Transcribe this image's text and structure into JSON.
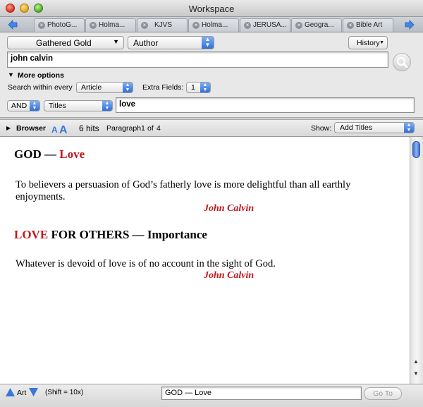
{
  "window": {
    "title": "Workspace"
  },
  "tabs": [
    {
      "label": "PhotoG..."
    },
    {
      "label": "Holma..."
    },
    {
      "label": "KJVS"
    },
    {
      "label": "Holma..."
    },
    {
      "label": "JERUSA..."
    },
    {
      "label": "Geogra..."
    },
    {
      "label": "Bible Art"
    }
  ],
  "search": {
    "library_select": "Gathered Gold",
    "field_select": "Author",
    "history_button": "History",
    "query_value": "john calvin",
    "more_options_label": "More options",
    "search_within_label": "Search within every",
    "search_within_select": "Article",
    "extra_fields_label": "Extra Fields:",
    "extra_fields_select": "1",
    "operator_select": "AND",
    "extra_field_select": "Titles",
    "extra_query_value": "love"
  },
  "browser": {
    "browser_label": "Browser",
    "hits": "6 hits",
    "paragraph_label": "Paragraph",
    "paragraph_current": "1",
    "paragraph_of": "of",
    "paragraph_total": "4",
    "show_label": "Show:",
    "show_select": "Add Titles"
  },
  "content": {
    "entries": [
      {
        "heading_black": "GOD —",
        "heading_red": "Love",
        "text": "To believers a persuasion of God’s fatherly love is more delightful than all earthly enjoyments.",
        "author": "John Calvin"
      },
      {
        "heading_red": "LOVE",
        "heading_black": "FOR OTHERS — Importance",
        "text": "Whatever is devoid of love is of no account in the sight of God.",
        "author": "John Calvin"
      }
    ]
  },
  "bottom": {
    "art_label": "Art",
    "shift_hint": "(Shift = 10x)",
    "goto_value": "GOD — Love",
    "goto_button": "Go To"
  },
  "colors": {
    "accent_red": "#c4161c",
    "select_blue": "#2f6fd8"
  }
}
